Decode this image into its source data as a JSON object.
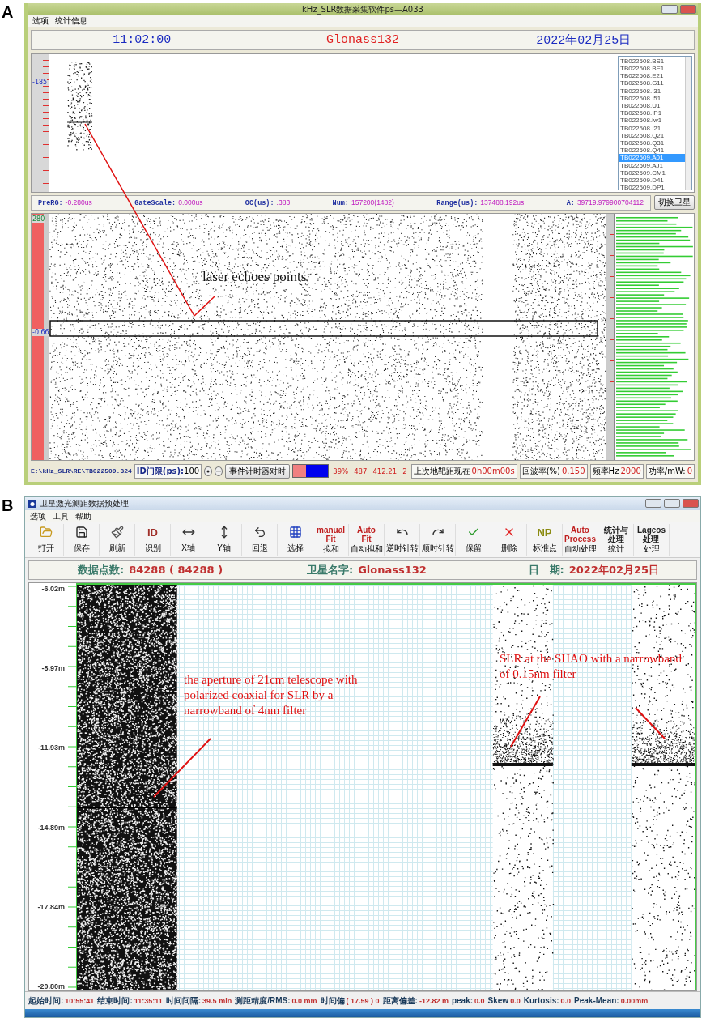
{
  "panel_a": {
    "label": "A",
    "title": "kHz_SLR数据采集软件ps—A033",
    "menu": [
      "选项",
      "统计信息"
    ],
    "header": {
      "time": "11:02:00",
      "satellite": "Glonass132",
      "date": "2022年02月25日"
    },
    "top_plot": {
      "axis_label": "-185",
      "files": [
        {
          "name": "TB022508.BS1",
          "selected": false
        },
        {
          "name": "TB022508.BE1",
          "selected": false
        },
        {
          "name": "TB022508.E21",
          "selected": false
        },
        {
          "name": "TB022508.G11",
          "selected": false
        },
        {
          "name": "TB022508.I31",
          "selected": false
        },
        {
          "name": "TB022508.I51",
          "selected": false
        },
        {
          "name": "TB022508.U1",
          "selected": false
        },
        {
          "name": "TB022508.IP1",
          "selected": false
        },
        {
          "name": "TB022508.lw1",
          "selected": false
        },
        {
          "name": "TB022508.I21",
          "selected": false
        },
        {
          "name": "TB022508.Q21",
          "selected": false
        },
        {
          "name": "TB022508.Q31",
          "selected": false
        },
        {
          "name": "TB022508.Q41",
          "selected": false
        },
        {
          "name": "TB022509.A01",
          "selected": true
        },
        {
          "name": "TB022509.AJ1",
          "selected": false
        },
        {
          "name": "TB022509.CM1",
          "selected": false
        },
        {
          "name": "TB022509.D41",
          "selected": false
        },
        {
          "name": "TB022509.DP1",
          "selected": false
        }
      ]
    },
    "info_bar": [
      {
        "label": "PreRG:",
        "value": "-0.280us"
      },
      {
        "label": "GateScale:",
        "value": "0.000us"
      },
      {
        "label": "OC(us):",
        "value": ".383"
      },
      {
        "label": "Num:",
        "value": "157200(1482)"
      },
      {
        "label": "Range(us):",
        "value": "137488.192us"
      },
      {
        "label": "A:",
        "value": "39719.979900704112"
      }
    ],
    "switch_button": "切换卫星",
    "bottom_plot": {
      "axis_labels": [
        "280",
        "-0.66"
      ],
      "annotation": "laser echoes points"
    },
    "status_bar": {
      "path": "E:\\kHz_SLR\\RE\\TB022509.324",
      "threshold_label": "ID门限(ps):",
      "threshold": "100",
      "sync_button": "事件计时器对时",
      "level": 0.37,
      "readings": [
        "39%",
        "487",
        "412.21",
        "2"
      ],
      "fields": [
        {
          "label": "上次地靶距现在",
          "value": "0h00m00s"
        },
        {
          "label": "回波率(%)",
          "value": "0.150"
        },
        {
          "label": "频率Hz",
          "value": "2000"
        },
        {
          "label": "功率/mW:",
          "value": "0"
        }
      ]
    }
  },
  "panel_b": {
    "label": "B",
    "title": "卫星激光测距数据预处理",
    "menu": [
      "选项",
      "工具",
      "帮助"
    ],
    "toolbar": [
      {
        "kind": "icon",
        "label": "打开"
      },
      {
        "kind": "icon",
        "label": "保存"
      },
      {
        "kind": "icon",
        "label": "刷新"
      },
      {
        "kind": "glyph",
        "glyph": "ID",
        "color": "#a0302a",
        "label": "识别"
      },
      {
        "kind": "icon",
        "label": "X轴"
      },
      {
        "kind": "icon",
        "label": "Y轴"
      },
      {
        "kind": "icon",
        "label": "回退"
      },
      {
        "kind": "icon",
        "label": "选择"
      },
      {
        "kind": "glyph",
        "glyph": "manual\nFit",
        "color": "#c02020",
        "label": "拟和"
      },
      {
        "kind": "glyph",
        "glyph": "Auto\nFit",
        "color": "#c02020",
        "label": "自动拟和"
      },
      {
        "kind": "icon",
        "label": "逆时针转"
      },
      {
        "kind": "icon",
        "label": "顺时针转"
      },
      {
        "kind": "icon",
        "label": "保留"
      },
      {
        "kind": "icon",
        "label": "删除"
      },
      {
        "kind": "glyph",
        "glyph": "NP",
        "color": "#8a8a10",
        "label": "标准点"
      },
      {
        "kind": "glyph",
        "glyph": "Auto\nProcess",
        "color": "#c02020",
        "label": "自动处理"
      },
      {
        "kind": "cjk_glyph",
        "glyph": "统计与处理",
        "color": "#202020",
        "label": "统计"
      },
      {
        "kind": "glyph",
        "glyph": "Lageos\n处理",
        "color": "#202020",
        "label": "处理"
      }
    ],
    "info_bar": [
      {
        "label": "数据点数:",
        "value": "84288 ( 84288 )"
      },
      {
        "label": "卫星名字:",
        "value": "Glonass132"
      },
      {
        "label": "日　期:",
        "value": "2022年02月25日"
      }
    ],
    "y_axis": [
      "-6.02m",
      "-8.97m",
      "-11.93m",
      "-14.89m",
      "-17.84m",
      "-20.80m"
    ],
    "annotations": [
      "the aperture of 21cm telescope with polarized coaxial for SLR by a narrowband of 4nm filter",
      "SLR at the SHAO with a narrowband of 0.15nm filter"
    ],
    "status_bar": [
      {
        "label": "起始时间:",
        "value": "10:55:41"
      },
      {
        "label": "结束时间:",
        "value": "11:35:11"
      },
      {
        "label": "时间间隔:",
        "value": "39.5 min"
      },
      {
        "label": "测距精度/RMS:",
        "value": "0.0 mm"
      },
      {
        "label": "时间偏",
        "value": "( 17.59 ) 0"
      },
      {
        "label": "距离偏差:",
        "value": "-12.82 m"
      },
      {
        "label": "peak:",
        "value": "0.0"
      },
      {
        "label": "Skew",
        "value": "0.0"
      },
      {
        "label": "Kurtosis:",
        "value": "0.0"
      },
      {
        "label": "Peak-Mean:",
        "value": "0.00mm"
      }
    ]
  }
}
